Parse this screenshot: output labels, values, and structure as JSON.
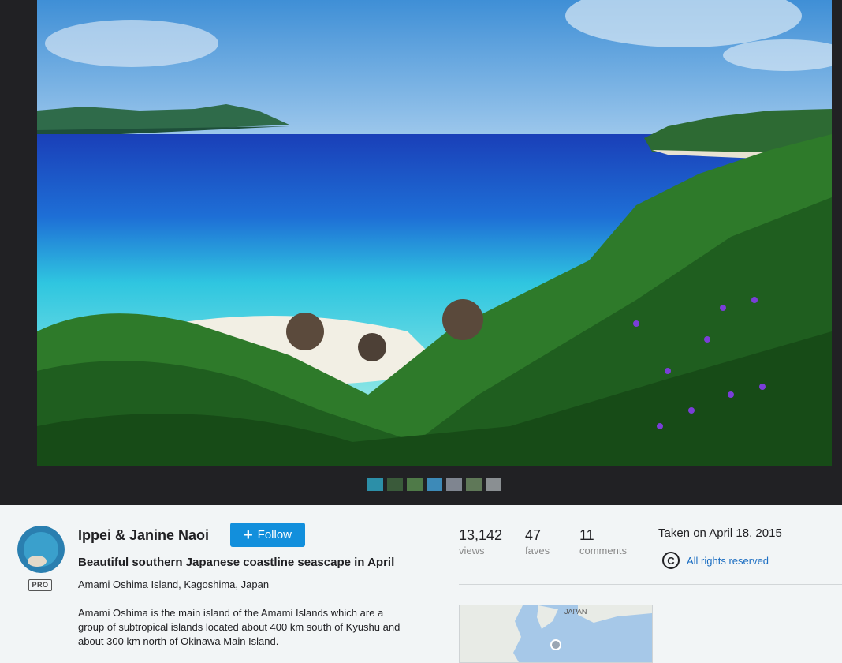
{
  "photo": {
    "alt": "Beautiful southern Japanese coastline seascape in April"
  },
  "filmstrip": [
    {
      "color": "#2c8fa8"
    },
    {
      "color": "#3a5a3a"
    },
    {
      "color": "#4f7a48"
    },
    {
      "color": "#3d8ab8"
    },
    {
      "color": "#7f8590"
    },
    {
      "color": "#5f7858"
    },
    {
      "color": "#8a8f92"
    }
  ],
  "owner": {
    "name": "Ippei & Janine Naoi",
    "badge": "PRO"
  },
  "follow_button": {
    "label": "Follow",
    "icon": "plus-icon"
  },
  "photo_info": {
    "title": "Beautiful southern Japanese coastline seascape in April",
    "location": "Amami Oshima Island, Kagoshima, Japan",
    "description": "Amami Oshima is the main island of the Amami Islands which are a group of subtropical islands located about 400 km south of Kyushu and about 300 km north of Okinawa Main Island."
  },
  "stats": {
    "views": {
      "value": "13,142",
      "label": "views"
    },
    "faves": {
      "value": "47",
      "label": "faves"
    },
    "comments": {
      "value": "11",
      "label": "comments"
    }
  },
  "meta": {
    "taken": "Taken on April 18, 2015",
    "license": "All rights reserved",
    "license_icon": "copyright-icon"
  },
  "map": {
    "label": "JAPAN"
  },
  "colors": {
    "accent": "#128fdc",
    "link": "#1c6ec2",
    "viewer_bg": "#212124"
  }
}
